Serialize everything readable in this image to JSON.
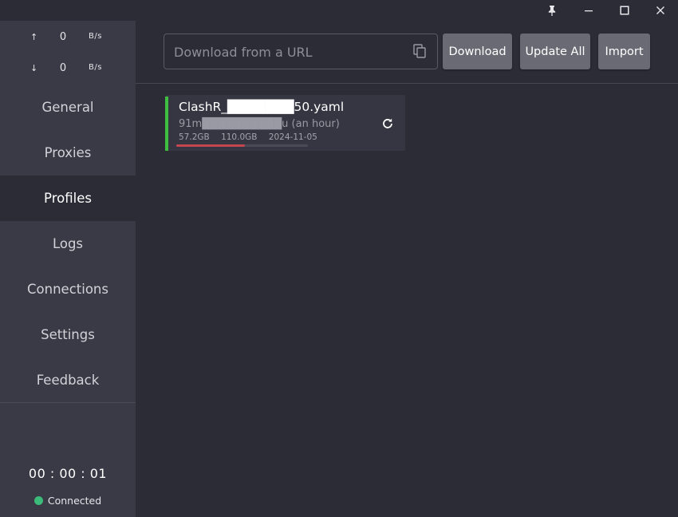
{
  "titlebar": {
    "buttons": [
      {
        "icon": "pin-icon"
      },
      {
        "icon": "minimize-icon"
      },
      {
        "icon": "maximize-icon"
      },
      {
        "icon": "close-icon"
      }
    ]
  },
  "traffic": {
    "upload": {
      "arrow": "↑",
      "value": "0",
      "unit": "B/s"
    },
    "download": {
      "arrow": "↓",
      "value": "0",
      "unit": "B/s"
    }
  },
  "nav": {
    "items": [
      {
        "label": "General"
      },
      {
        "label": "Proxies"
      },
      {
        "label": "Profiles"
      },
      {
        "label": "Logs"
      },
      {
        "label": "Connections"
      },
      {
        "label": "Settings"
      },
      {
        "label": "Feedback"
      }
    ],
    "active": "Profiles"
  },
  "status": {
    "timer": "00 : 00 : 01",
    "connection": "Connected",
    "connection_color": "#3cba7a"
  },
  "toolbar": {
    "url_placeholder": "Download from a URL",
    "download_label": "Download",
    "update_all_label": "Update All",
    "import_label": "Import"
  },
  "profiles": [
    {
      "name": "ClashR_███████50.yaml",
      "meta": "91m██████████u (an hour)",
      "used": "57.2GB",
      "total": "110.0GB",
      "expires": "2024-11-05",
      "usage_fraction": 0.52,
      "selected_color": "#3fbf3f",
      "usage_color": "#c4464f"
    }
  ],
  "colors": {
    "background": "#2c2c37",
    "sidebar": "#3a3a46",
    "button": "#6a6a74"
  }
}
